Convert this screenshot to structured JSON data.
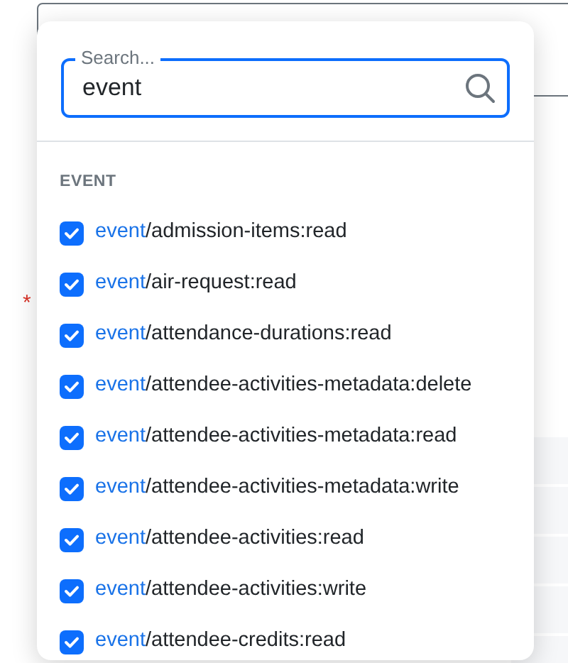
{
  "background": {
    "required_mark": "*"
  },
  "search": {
    "placeholder": "Search...",
    "value": "event"
  },
  "group": {
    "heading": "EVENT",
    "items": [
      {
        "match": "event",
        "rest": "/admission-items:read",
        "checked": true
      },
      {
        "match": "event",
        "rest": "/air-request:read",
        "checked": true
      },
      {
        "match": "event",
        "rest": "/attendance-durations:read",
        "checked": true
      },
      {
        "match": "event",
        "rest": "/attendee-activities-metadata:delete",
        "checked": true
      },
      {
        "match": "event",
        "rest": "/attendee-activities-metadata:read",
        "checked": true
      },
      {
        "match": "event",
        "rest": "/attendee-activities-metadata:write",
        "checked": true
      },
      {
        "match": "event",
        "rest": "/attendee-activities:read",
        "checked": true
      },
      {
        "match": "event",
        "rest": "/attendee-activities:write",
        "checked": true
      },
      {
        "match": "event",
        "rest": "/attendee-credits:read",
        "checked": true
      }
    ]
  }
}
